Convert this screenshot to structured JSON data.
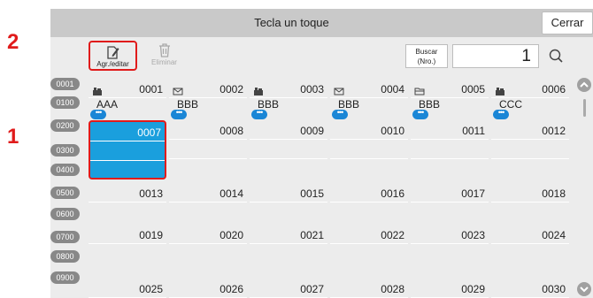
{
  "callouts": [
    "2",
    "1"
  ],
  "title": "Tecla un toque",
  "close_label": "Cerrar",
  "toolbar": {
    "add_edit_label": "Agr./editar",
    "delete_label": "Eliminar"
  },
  "search": {
    "label_line1": "Buscar",
    "label_line2": "(Nro.)",
    "value": "1"
  },
  "row_labels": [
    "0001",
    "0100",
    "0200",
    "0300",
    "0400",
    "0500",
    "0600",
    "0700",
    "0800",
    "0900"
  ],
  "row1": [
    {
      "num": "0001",
      "icon": "fax",
      "name": "AAA"
    },
    {
      "num": "0002",
      "icon": "email",
      "name": "BBB"
    },
    {
      "num": "0003",
      "icon": "fax",
      "name": "BBB"
    },
    {
      "num": "0004",
      "icon": "email",
      "name": "BBB"
    },
    {
      "num": "0005",
      "icon": "folder",
      "name": "BBB"
    },
    {
      "num": "0006",
      "icon": "fax",
      "name": "CCC"
    }
  ],
  "row2": [
    "0007",
    "0008",
    "0009",
    "0010",
    "0011",
    "0012"
  ],
  "row3": [
    "0013",
    "0014",
    "0015",
    "0016",
    "0017",
    "0018"
  ],
  "row4": [
    "0019",
    "0020",
    "0021",
    "0022",
    "0023",
    "0024"
  ],
  "row5": [
    "0025",
    "0026",
    "0027",
    "0028",
    "0029",
    "0030"
  ],
  "badge_text": "•••",
  "colors": {
    "selected": "#1a9fdd",
    "highlight": "#e01b1b",
    "badge": "#1a86d6"
  }
}
